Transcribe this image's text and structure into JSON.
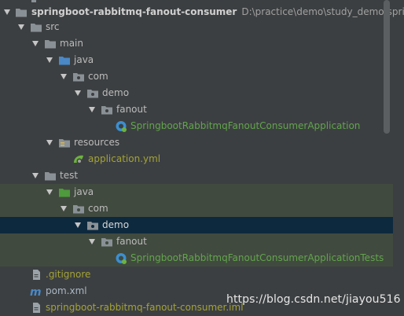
{
  "project": {
    "name": "springboot-rabbitmq-fanout-consumer",
    "path": "D:\\practice\\demo\\study_demo\\sprin"
  },
  "tree": {
    "src": "src",
    "main": "main",
    "java_main": "java",
    "com_main": "com",
    "demo_main": "demo",
    "fanout_main": "fanout",
    "app_class": "SpringbootRabbitmqFanoutConsumerApplication",
    "resources": "resources",
    "app_yml": "application.yml",
    "test": "test",
    "java_test": "java",
    "com_test": "com",
    "demo_test": "demo",
    "fanout_test": "fanout",
    "test_class": "SpringbootRabbitmqFanoutConsumerApplicationTests",
    "gitignore": ".gitignore",
    "pom": "pom.xml",
    "iml": "springboot-rabbitmq-fanout-consumer.iml"
  },
  "watermark": "https://blog.csdn.net/jiayou516",
  "colors": {
    "background": "#3c3f41",
    "selection_green": "#414a3f",
    "selection_blue": "#0d293e",
    "file_green": "#62a54d",
    "file_olive": "#a3a336"
  },
  "icons": {
    "folder": "folder-icon",
    "package": "package-icon",
    "source_root": "source-root-icon",
    "test_root": "test-root-icon",
    "resources": "resources-icon",
    "spring_class": "spring-boot-class-icon",
    "spring_yml": "spring-yml-icon",
    "file": "text-file-icon",
    "maven": "maven-icon"
  }
}
